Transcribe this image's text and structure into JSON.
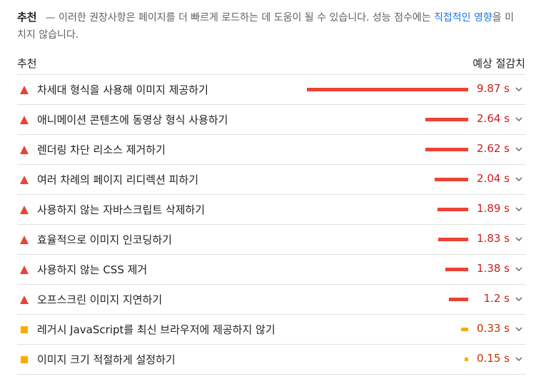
{
  "intro": {
    "heading": "추천",
    "text": "— 이러한 권장사항은 페이지를 더 빠르게 로드하는 데 도움이 될 수 있습니다. 성능 점수에는 ",
    "link_text": "직접적인 영향",
    "text_after": "을 미치지 않습니다."
  },
  "columns": {
    "left": "추천",
    "right": "예상 절감치"
  },
  "colors": {
    "fail": "#eb4335",
    "average": "#fbac00",
    "average_text": "#c33300",
    "fail_text": "#c5221f"
  },
  "max_seconds": 9.87,
  "items": [
    {
      "label": "차세대 형식을 사용해 이미지 제공하기",
      "value": "9.87 s",
      "seconds": 9.87,
      "severity": "fail",
      "icon": "warning-triangle-icon"
    },
    {
      "label": "애니메이션 콘텐츠에 동영상 형식 사용하기",
      "value": "2.64 s",
      "seconds": 2.64,
      "severity": "fail",
      "icon": "warning-triangle-icon"
    },
    {
      "label": "렌더링 차단 리소스 제거하기",
      "value": "2.62 s",
      "seconds": 2.62,
      "severity": "fail",
      "icon": "warning-triangle-icon"
    },
    {
      "label": "여러 차례의 페이지 리디렉션 피하기",
      "value": "2.04 s",
      "seconds": 2.04,
      "severity": "fail",
      "icon": "warning-triangle-icon"
    },
    {
      "label": "사용하지 않는 자바스크립트 삭제하기",
      "value": "1.89 s",
      "seconds": 1.89,
      "severity": "fail",
      "icon": "warning-triangle-icon"
    },
    {
      "label": "효율적으로 이미지 인코딩하기",
      "value": "1.83 s",
      "seconds": 1.83,
      "severity": "fail",
      "icon": "warning-triangle-icon"
    },
    {
      "label": "사용하지 않는 CSS 제거",
      "value": "1.38 s",
      "seconds": 1.38,
      "severity": "fail",
      "icon": "warning-triangle-icon"
    },
    {
      "label": "오프스크린 이미지 지연하기",
      "value": "1.2 s",
      "seconds": 1.2,
      "severity": "fail",
      "icon": "warning-triangle-icon"
    },
    {
      "label": "레거시 JavaScript를 최신 브라우저에 제공하지 않기",
      "value": "0.33 s",
      "seconds": 0.33,
      "severity": "average",
      "icon": "average-square-icon"
    },
    {
      "label": "이미지 크기 적절하게 설정하기",
      "value": "0.15 s",
      "seconds": 0.15,
      "severity": "average",
      "icon": "average-square-icon"
    }
  ]
}
